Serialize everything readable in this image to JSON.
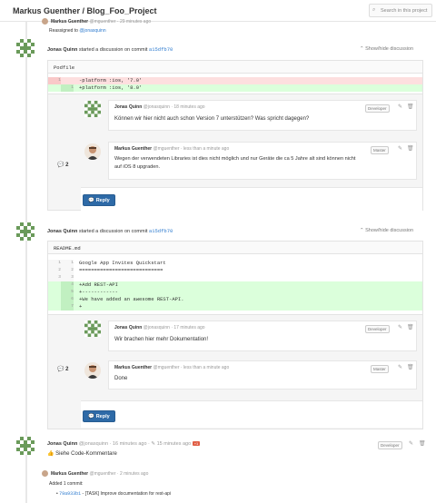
{
  "header": {
    "title": "Markus Guenther / Blog_Foo_Project",
    "search_placeholder": "Search in this project"
  },
  "top_event": {
    "author": "Markus Guenther",
    "meta": "@mguenther · 29 minutes ago",
    "action": "Reassigned to ",
    "assignee": "@jonasquinn"
  },
  "discussion1": {
    "author": "Jonas Quinn",
    "action": "started a discussion on commit",
    "sha": "a15dfb70",
    "toggle": "Show/hide discussion",
    "file": "Podfile",
    "lines": [
      {
        "n1": "1",
        "n2": "",
        "code": "-platform :ios, '7.0'",
        "type": "del"
      },
      {
        "n1": "",
        "n2": "1",
        "code": "+platform :ios, '8.0'",
        "type": "add"
      }
    ],
    "count": "2",
    "notes": [
      {
        "author": "Jonas Quinn",
        "meta": "@jonasquinn · 18 minutes ago",
        "role": "Developer",
        "text": "Können wir hier nicht auch schon Version 7 unterstützen? Was spricht dagegen?"
      },
      {
        "author": "Markus Guenther",
        "meta": "@mguenther · less than a minute ago",
        "role": "Master",
        "text1": "Wegen der verwendeten Libraries ist dies nicht möglich und nur Geräte die ca 5 Jahre alt sind können nicht",
        "text2": "auf iOS 8 upgraden."
      }
    ],
    "reply": "Reply"
  },
  "discussion2": {
    "author": "Jonas Quinn",
    "action": "started a discussion on commit",
    "sha": "a15dfb70",
    "toggle": "Show/hide discussion",
    "file": "README.md",
    "lines": [
      {
        "n1": "1",
        "n2": "1",
        "code": "Google App Invites Quickstart",
        "type": "normal"
      },
      {
        "n1": "2",
        "n2": "2",
        "code": "============================",
        "type": "normal"
      },
      {
        "n1": "3",
        "n2": "3",
        "code": "",
        "type": "normal"
      },
      {
        "n1": "",
        "n2": "4",
        "code": "+Add REST-API",
        "type": "add"
      },
      {
        "n1": "",
        "n2": "5",
        "code": "+------------",
        "type": "add"
      },
      {
        "n1": "",
        "n2": "6",
        "code": "+We have added an awesome REST-API.",
        "type": "add"
      },
      {
        "n1": "",
        "n2": "7",
        "code": "+",
        "type": "add"
      }
    ],
    "count": "2",
    "notes": [
      {
        "author": "Jonas Quinn",
        "meta": "@jonasquinn · 17 minutes ago",
        "role": "Developer",
        "text": "Wir brachen hier mehr Dokumentation!"
      },
      {
        "author": "Markus Guenther",
        "meta": "@mguenther · less than a minute ago",
        "role": "Master",
        "text": "Done"
      }
    ],
    "reply": "Reply"
  },
  "comment": {
    "author": "Jonas Quinn",
    "meta": "@jonasquinn · 16 minutes ago · ",
    "edited": "15 minutes ago",
    "badge": "+1",
    "role": "Developer",
    "text": "Siehe Code-Kommentare"
  },
  "commit_event": {
    "author": "Markus Guenther",
    "meta": "@mguenther · 2 minutes ago",
    "summary": "Added 1 commit:",
    "sha": "79a933b1",
    "message": " - [TASK] Improve documentation for rest-api"
  }
}
